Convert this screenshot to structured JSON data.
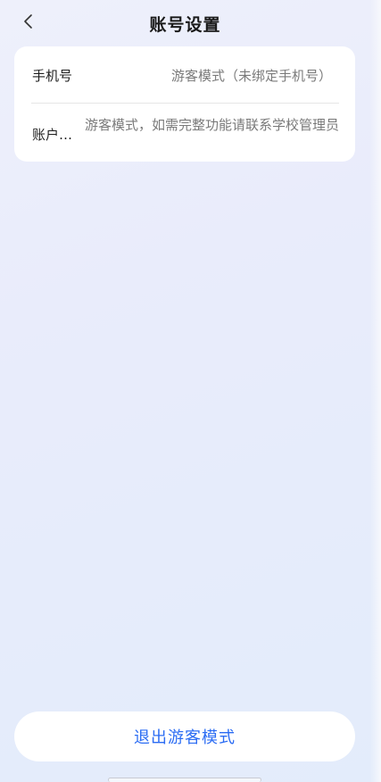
{
  "header": {
    "title": "账号设置",
    "back_icon": "chevron-left-icon"
  },
  "settings_card": {
    "phone_row": {
      "label": "手机号",
      "value": "游客模式（未绑定手机号）"
    },
    "account_row": {
      "label": "账户…",
      "value": "游客模式，如需完整功能请联系学校管理员"
    }
  },
  "footer": {
    "exit_label": "退出游客模式"
  },
  "colors": {
    "accent": "#2b6cf3",
    "title": "#1a1a1a",
    "secondary_text": "#7a7a7a",
    "card_bg": "#ffffff"
  }
}
